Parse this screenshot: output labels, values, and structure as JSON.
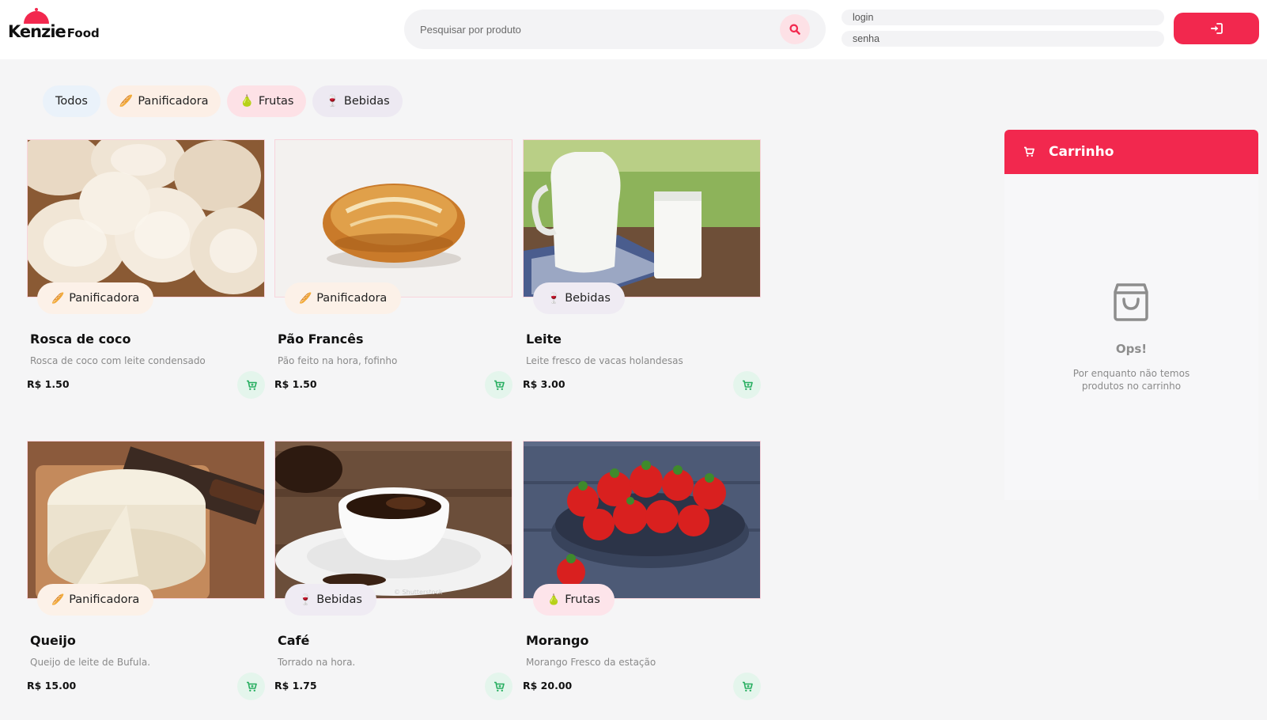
{
  "header": {
    "logo": {
      "brand": "Kenzie",
      "suffix": "Food"
    },
    "search": {
      "placeholder": "Pesquisar por produto"
    },
    "login": {
      "placeholder": "login"
    },
    "password": {
      "placeholder": "senha"
    }
  },
  "filters": [
    {
      "label": "Todos"
    },
    {
      "label": "Panificadora",
      "icon": "bread-icon"
    },
    {
      "label": "Frutas",
      "icon": "fruit-icon"
    },
    {
      "label": "Bebidas",
      "icon": "wine-glass-icon"
    }
  ],
  "products": [
    {
      "name": "Rosca de coco",
      "category": "Panificadora",
      "description": "Rosca de coco com leite condensado",
      "price": "R$ 1.50"
    },
    {
      "name": "Pão Francês",
      "category": "Panificadora",
      "description": "Pão feito na hora, fofinho",
      "price": "R$ 1.50"
    },
    {
      "name": "Leite",
      "category": "Bebidas",
      "description": "Leite fresco de vacas holandesas",
      "price": "R$ 3.00"
    },
    {
      "name": "Queijo",
      "category": "Panificadora",
      "description": "Queijo de leite de Bufula.",
      "price": "R$ 15.00"
    },
    {
      "name": "Café",
      "category": "Bebidas",
      "description": "Torrado na hora.",
      "price": "R$ 1.75"
    },
    {
      "name": "Morango",
      "category": "Frutas",
      "description": "Morango Fresco da estação",
      "price": "R$ 20.00"
    }
  ],
  "cart": {
    "title": "Carrinho",
    "empty_title": "Ops!",
    "empty_text": "Por enquanto não temos produtos no carrinho"
  },
  "colors": {
    "primary": "#f2284e",
    "success": "#27ae60",
    "background": "#f5f5f6"
  }
}
